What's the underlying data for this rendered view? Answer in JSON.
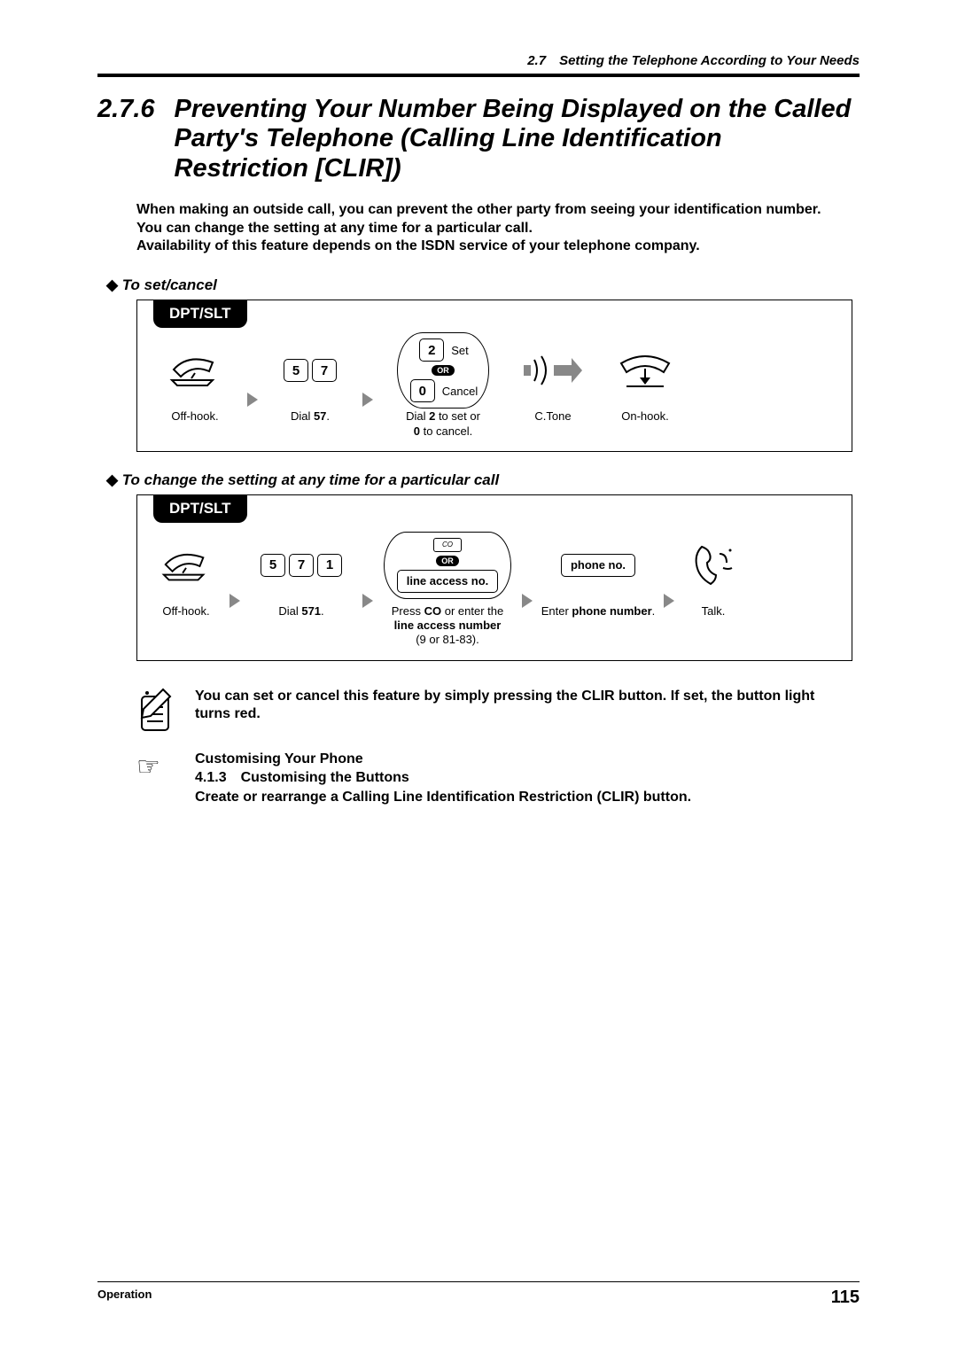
{
  "header": {
    "running": "2.7 Setting the Telephone According to Your Needs"
  },
  "section": {
    "number": "2.7.6",
    "title": "Preventing Your Number Being Displayed on the Called Party's Telephone (Calling Line Identification Restriction [CLIR])"
  },
  "intro": {
    "l1": "When making an outside call, you can prevent the other party from seeing your identification number.",
    "l2": "You can change the setting at any time for a particular call.",
    "l3": "Availability of this feature depends on the ISDN service of your telephone company."
  },
  "sub1": "To set/cancel",
  "sub2": "To change the setting at any time for a particular call",
  "tab": "DPT/SLT",
  "p1": {
    "s1": "Off-hook.",
    "s2a": "Dial ",
    "s2b": "57",
    "s2c": ".",
    "k5": "5",
    "k7": "7",
    "k2": "2",
    "k0": "0",
    "setLabel": "Set",
    "cancelLabel": "Cancel",
    "or": "OR",
    "s3a": "Dial ",
    "s3b": "2",
    "s3c": " to set or",
    "s3d": "0",
    "s3e": " to cancel.",
    "ctone": "C.Tone",
    "s5": "On-hook."
  },
  "p2": {
    "s1": "Off-hook.",
    "k5": "5",
    "k7": "7",
    "k1": "1",
    "s2a": "Dial ",
    "s2b": "571",
    "s2c": ".",
    "or": "OR",
    "lineAccess": "line access no.",
    "s3a": "Press ",
    "s3b": "CO",
    "s3c": " or enter the ",
    "s3d": "line access number",
    "s3e": "(9 or 81-83).",
    "phoneNo": "phone no.",
    "s4a": "Enter ",
    "s4b": "phone number",
    "s4c": ".",
    "s5": "Talk."
  },
  "note": "You can set or cancel this feature by simply pressing the CLIR button. If set, the button light turns red.",
  "ref": {
    "h": "Customising Your Phone",
    "line2": "4.1.3 Customising the Buttons",
    "line3": "Create or rearrange a Calling Line Identification Restriction (CLIR) button."
  },
  "footer": {
    "left": "Operation",
    "page": "115"
  }
}
